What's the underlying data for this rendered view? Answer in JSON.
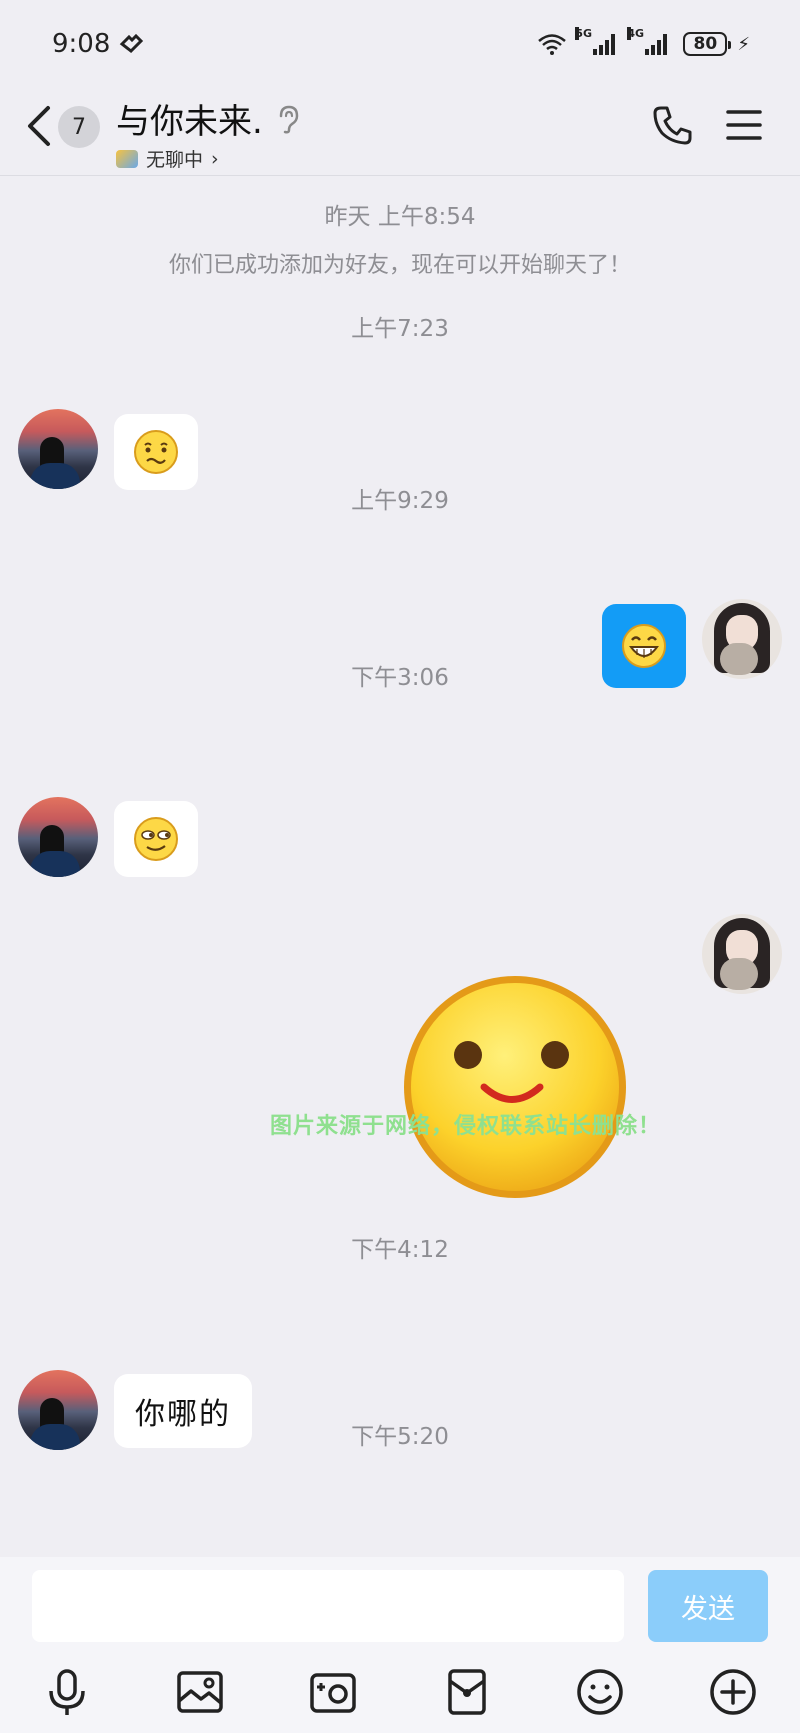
{
  "status_bar": {
    "time": "9:08",
    "network1": "5G",
    "network2": "4G",
    "battery": "80"
  },
  "header": {
    "unread_count": "7",
    "title": "与你未来.",
    "subtitle": "无聊中",
    "subtitle_arrow": "›"
  },
  "messages": {
    "ts1": "昨天 上午8:54",
    "system": "你们已成功添加为好友，现在可以开始聊天了！",
    "ts2": "上午7:23",
    "ts3": "上午9:29",
    "ts4": "下午3:06",
    "watermark": "图片来源于网络，侵权联系站长删除！",
    "ts5": "下午4:12",
    "text1": "你哪的",
    "ts6": "下午5:20"
  },
  "input": {
    "value": "",
    "send_label": "发送"
  },
  "colors": {
    "background": "#efeef3",
    "accent_blue": "#139cf6",
    "send_disabled": "#8bcdfa",
    "watermark_green": "#8fe08f"
  },
  "icons": [
    "back-icon",
    "ear-icon",
    "phone-icon",
    "menu-icon",
    "mic-icon",
    "image-icon",
    "camera-icon",
    "red-packet-icon",
    "emoji-icon",
    "plus-icon"
  ]
}
